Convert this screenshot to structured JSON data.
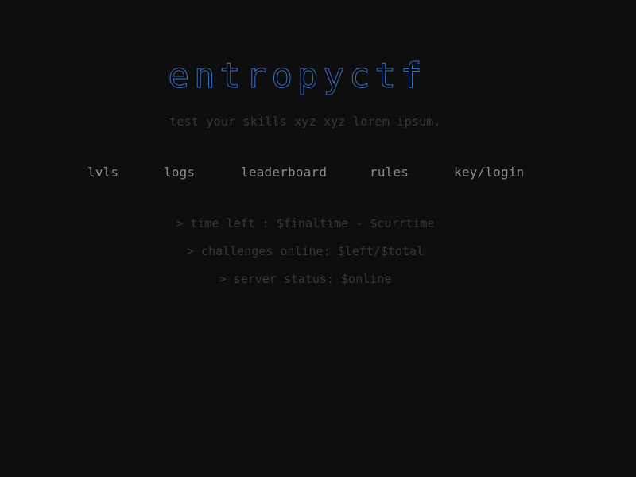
{
  "header": {
    "logo": "entropyctf",
    "tagline": "test your skills xyz xyz lorem ipsum."
  },
  "nav": {
    "items": [
      {
        "label": "lvls"
      },
      {
        "label": "logs"
      },
      {
        "label": "leaderboard"
      },
      {
        "label": "rules"
      },
      {
        "label": "key/login"
      }
    ]
  },
  "status": {
    "time_left": "> time left : $finaltime - $currtime",
    "challenges_online": "> challenges online: $left/$total",
    "server_status": "> server status: $online"
  },
  "colors": {
    "background": "#0e0e0e",
    "logo_blue": "#3b72c9",
    "nav_text": "#8c8c8c",
    "muted_text": "#3a3a3a"
  }
}
